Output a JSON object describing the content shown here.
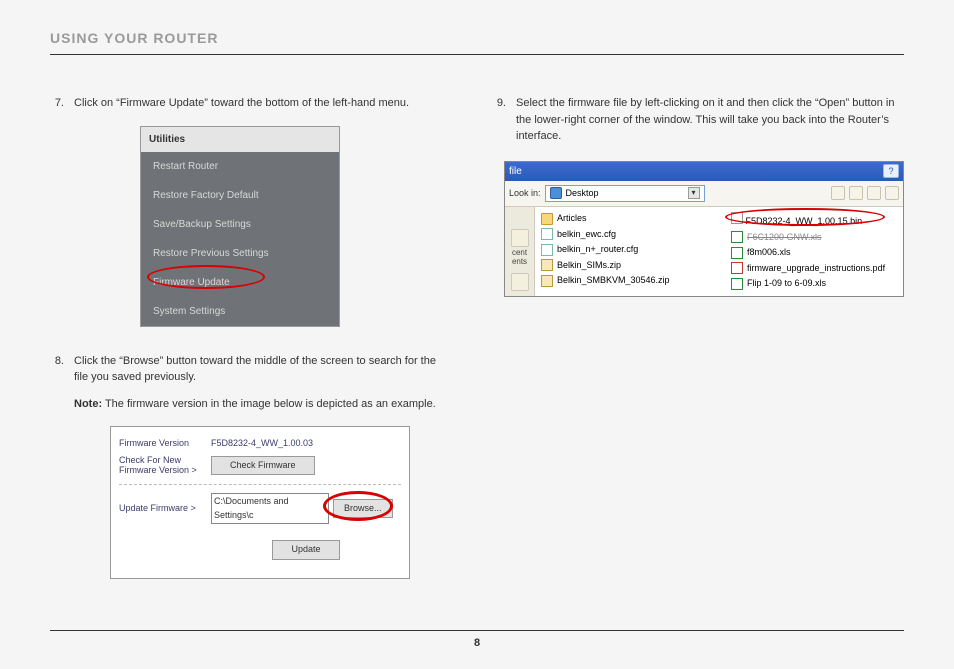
{
  "header": {
    "title": "USING YOUR ROUTER"
  },
  "footer": {
    "page_number": "8"
  },
  "steps": {
    "s7": {
      "num": "7.",
      "text": "Click on “Firmware Update” toward the bottom of the left-hand menu."
    },
    "s8": {
      "num": "8.",
      "text": "Click the “Browse” button toward the middle of the screen to search for the file you saved previously.",
      "note_label": "Note:",
      "note_text": " The firmware version in the image below is depicted as an example."
    },
    "s9": {
      "num": "9.",
      "text": "Select the firmware file by left-clicking on it and then click the “Open” button in the lower-right corner of the window. This will take you back into the Router’s interface."
    }
  },
  "utilities_menu": {
    "title": "Utilities",
    "items": [
      "Restart Router",
      "Restore Factory Default",
      "Save/Backup Settings",
      "Restore Previous Settings",
      "Firmware Update",
      "System Settings"
    ]
  },
  "firmware_panel": {
    "labels": {
      "version": "Firmware Version",
      "check": "Check For New Firmware Version >",
      "update": "Update Firmware >"
    },
    "version_value": "F5D8232-4_WW_1.00.03",
    "check_btn": "Check Firmware",
    "path_value": "C:\\Documents and Settings\\c",
    "browse_btn": "Browse...",
    "update_btn": "Update"
  },
  "file_dialog": {
    "title": "file",
    "help": "?",
    "lookin_label": "Look in:",
    "lookin_value": "Desktop",
    "sidebar": {
      "line1": "cent",
      "line2": "ents"
    },
    "left_files": [
      {
        "icon": "folder",
        "name": "Articles"
      },
      {
        "icon": "cfg",
        "name": "belkin_ewc.cfg"
      },
      {
        "icon": "cfg",
        "name": "belkin_n+_router.cfg"
      },
      {
        "icon": "zip",
        "name": "Belkin_SIMs.zip"
      },
      {
        "icon": "zip",
        "name": "Belkin_SMBKVM_30546.zip"
      }
    ],
    "right_files": [
      {
        "icon": "bin",
        "name": "F5D8232-4_WW_1.00.15.bin",
        "highlight": true
      },
      {
        "icon": "xls",
        "name": "F6C1200 GNW.xls",
        "strike": true
      },
      {
        "icon": "xls",
        "name": "f8m006.xls"
      },
      {
        "icon": "pdf",
        "name": "firmware_upgrade_instructions.pdf"
      },
      {
        "icon": "xls",
        "name": "Flip 1-09 to 6-09.xls"
      }
    ]
  }
}
